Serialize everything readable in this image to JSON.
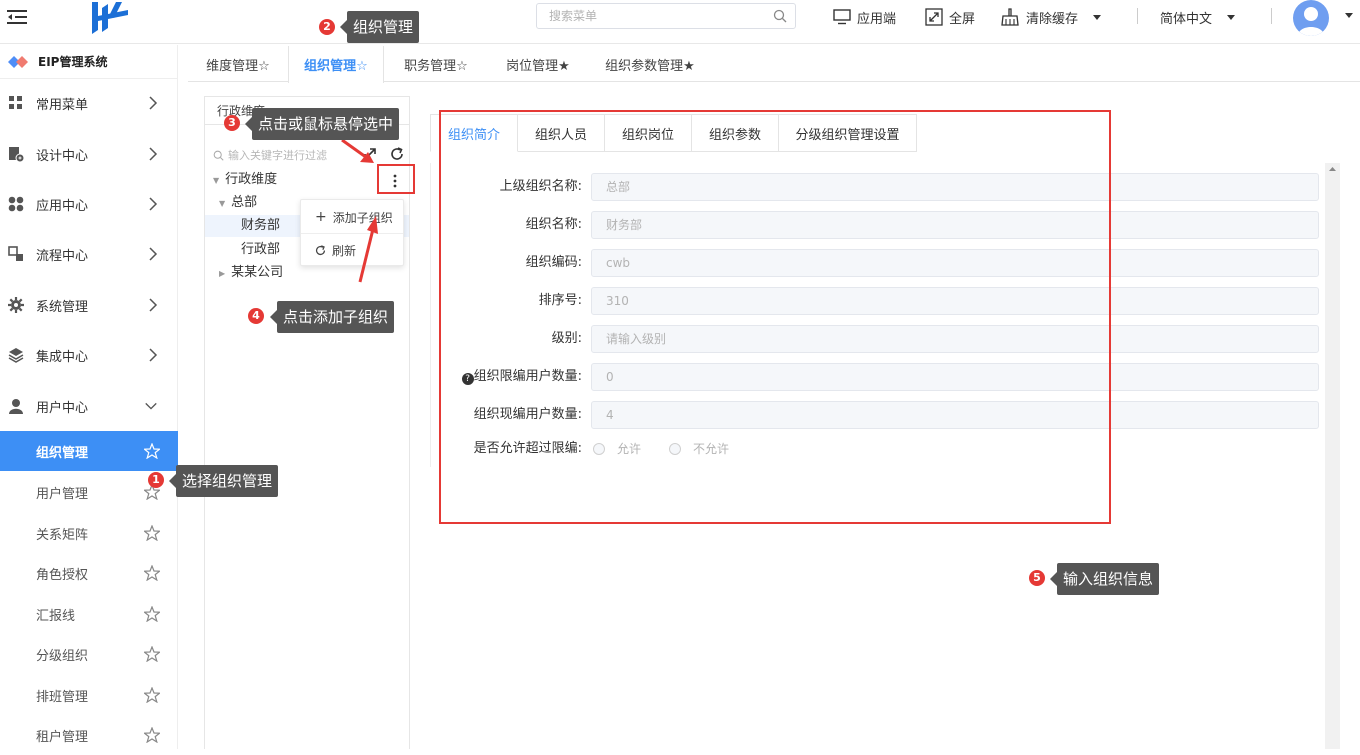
{
  "header": {
    "search_placeholder": "搜索菜单",
    "app_end": "应用端",
    "fullscreen": "全屏",
    "clear_cache": "清除缓存",
    "language": "简体中文"
  },
  "sidebar": {
    "brand": "EIP管理系统",
    "items": [
      {
        "label": "常用菜单"
      },
      {
        "label": "设计中心"
      },
      {
        "label": "应用中心"
      },
      {
        "label": "流程中心"
      },
      {
        "label": "系统管理"
      },
      {
        "label": "集成中心"
      },
      {
        "label": "用户中心"
      }
    ],
    "sub_items": [
      {
        "label": "组织管理"
      },
      {
        "label": "用户管理"
      },
      {
        "label": "关系矩阵"
      },
      {
        "label": "角色授权"
      },
      {
        "label": "汇报线"
      },
      {
        "label": "分级组织"
      },
      {
        "label": "排班管理"
      },
      {
        "label": "租户管理"
      }
    ]
  },
  "tabs": [
    {
      "label": "维度管理☆"
    },
    {
      "label": "组织管理☆"
    },
    {
      "label": "职务管理☆"
    },
    {
      "label": "岗位管理★"
    },
    {
      "label": "组织参数管理★"
    }
  ],
  "tree": {
    "dimension": "行政维度",
    "filter_placeholder": "输入关键字进行过滤",
    "root": "行政维度",
    "nodes": [
      {
        "label": "总部"
      },
      {
        "label": "财务部"
      },
      {
        "label": "行政部"
      },
      {
        "label": "某某公司"
      }
    ],
    "menu": {
      "add": "添加子组织",
      "refresh": "刷新"
    }
  },
  "form_tabs": [
    {
      "label": "组织简介"
    },
    {
      "label": "组织人员"
    },
    {
      "label": "组织岗位"
    },
    {
      "label": "组织参数"
    },
    {
      "label": "分级组织管理设置"
    }
  ],
  "form": {
    "rows": [
      {
        "label": "上级组织名称:",
        "value": "总部"
      },
      {
        "label": "组织名称:",
        "value": "财务部"
      },
      {
        "label": "组织编码:",
        "value": "cwb"
      },
      {
        "label": "排序号:",
        "value": "310"
      },
      {
        "label": "级别:",
        "value": "请输入级别"
      },
      {
        "label": "组织限编用户数量:",
        "value": "0"
      },
      {
        "label": "组织现编用户数量:",
        "value": "4"
      }
    ],
    "allow_label": "是否允许超过限编:",
    "allow_yes": "允许",
    "allow_no": "不允许"
  },
  "annotations": {
    "a1": "选择组织管理",
    "a2": "组织管理",
    "a3": "点击或鼠标悬停选中",
    "a4": "点击添加子组织",
    "a5": "输入组织信息",
    "n1": "1",
    "n2": "2",
    "n3": "3",
    "n4": "4",
    "n5": "5"
  }
}
